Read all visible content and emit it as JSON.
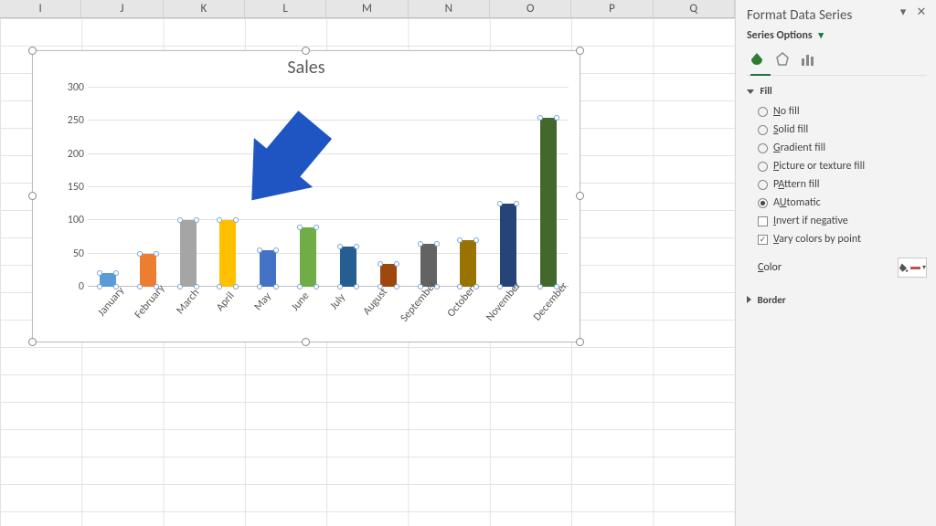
{
  "columns": [
    "I",
    "J",
    "K",
    "L",
    "M",
    "N",
    "O",
    "P",
    "Q"
  ],
  "chart_data": {
    "type": "bar",
    "title": "Sales",
    "xlabel": "",
    "ylabel": "",
    "ylim": [
      0,
      300
    ],
    "yticks": [
      0,
      50,
      100,
      150,
      200,
      250,
      300
    ],
    "categories": [
      "January",
      "February",
      "March",
      "April",
      "May",
      "June",
      "July",
      "August",
      "September",
      "October",
      "November",
      "December"
    ],
    "values": [
      20,
      50,
      100,
      100,
      55,
      90,
      60,
      35,
      65,
      70,
      125,
      255
    ],
    "colors": [
      "#5b9bd5",
      "#ed7d31",
      "#a5a5a5",
      "#ffc000",
      "#4472c4",
      "#70ad47",
      "#255e91",
      "#9e480e",
      "#636363",
      "#997300",
      "#264478",
      "#43682b"
    ]
  },
  "pane": {
    "title": "Format Data Series",
    "series_options_label": "Series Options",
    "sections": {
      "fill": {
        "label": "Fill",
        "options": {
          "no_fill": "No fill",
          "solid_fill": "Solid fill",
          "gradient_fill": "Gradient fill",
          "picture_fill": "Picture or texture fill",
          "pattern_fill": "Pattern fill",
          "automatic": "Automatic"
        },
        "selected": "automatic",
        "invert_if_negative": "Invert if negative",
        "invert_checked": false,
        "vary_by_point": "Vary colors by point",
        "vary_checked": true,
        "color_label": "Color"
      },
      "border": {
        "label": "Border"
      }
    },
    "accel": {
      "no_fill": "N",
      "solid_fill": "S",
      "gradient_fill": "G",
      "picture_fill": "P",
      "pattern_fill": "A",
      "automatic": "U",
      "invert": "I",
      "vary": "V",
      "color": "C"
    }
  }
}
